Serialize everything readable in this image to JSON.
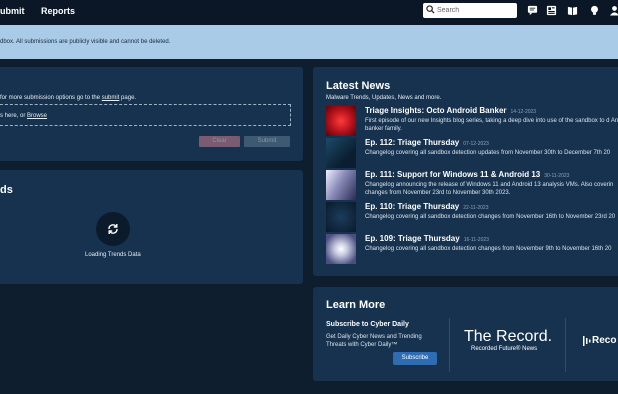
{
  "nav": {
    "submit": "ubmit",
    "reports": "Reports",
    "search_placeholder": "Search"
  },
  "banner": {
    "text": "dbox. All submissions are publicly visible and cannot be deleted."
  },
  "submit_panel": {
    "hint_pre": "for more submission options go to the ",
    "hint_link": "submit",
    "hint_post": " page.",
    "drop_pre": "s here, or ",
    "drop_link": "Browse",
    "clear_label": "Clear",
    "submit_label": "Submit"
  },
  "trends": {
    "heading": "ds",
    "loading": "Loading Trends Data"
  },
  "news": {
    "heading": "Latest News",
    "subtitle": "Malware Trends, Updates, News and more.",
    "items": [
      {
        "title": "Triage Insights: Octo Android Banker",
        "date": "14-12-2023",
        "desc": "First episode of our new Insights blog series, taking a deep dive into use of the sandbox to d Android banker family.",
        "color": "#c0141c"
      },
      {
        "title": "Ep. 112: Triage Thursday",
        "date": "07-12-2023",
        "desc": "Changelog covering all sandbox detection updates from November 30th to December 7th 20",
        "color": "#14324a"
      },
      {
        "title": "Ep. 111: Support for Windows 11 & Android 13",
        "date": "30-11-2023",
        "desc": "Changelog announcing the release of Windows 11 and Android 13 analysis VMs. Also coverin changes from November 23rd to November 30th 2023.",
        "color": "#8a8ab8"
      },
      {
        "title": "Ep. 110: Triage Thursday",
        "date": "22-11-2023",
        "desc": "Changelog covering all sandbox detection changes from November 16th to November 23rd 20",
        "color": "#0d2238"
      },
      {
        "title": "Ep. 109: Triage Thursday",
        "date": "16-11-2023",
        "desc": "Changelog covering all sandbox detection changes from November 9th to November 16th 20",
        "color": "#c7c9e0"
      }
    ]
  },
  "learn": {
    "heading": "Learn More",
    "sub_heading": "Subscribe to Cyber Daily",
    "desc": "Get Daily Cyber News and Trending Threats with Cyber Daily™",
    "button": "Subscribe",
    "record_title": "The Record.",
    "record_sub": "Recorded Future® News",
    "brand_partial": "Reco"
  }
}
